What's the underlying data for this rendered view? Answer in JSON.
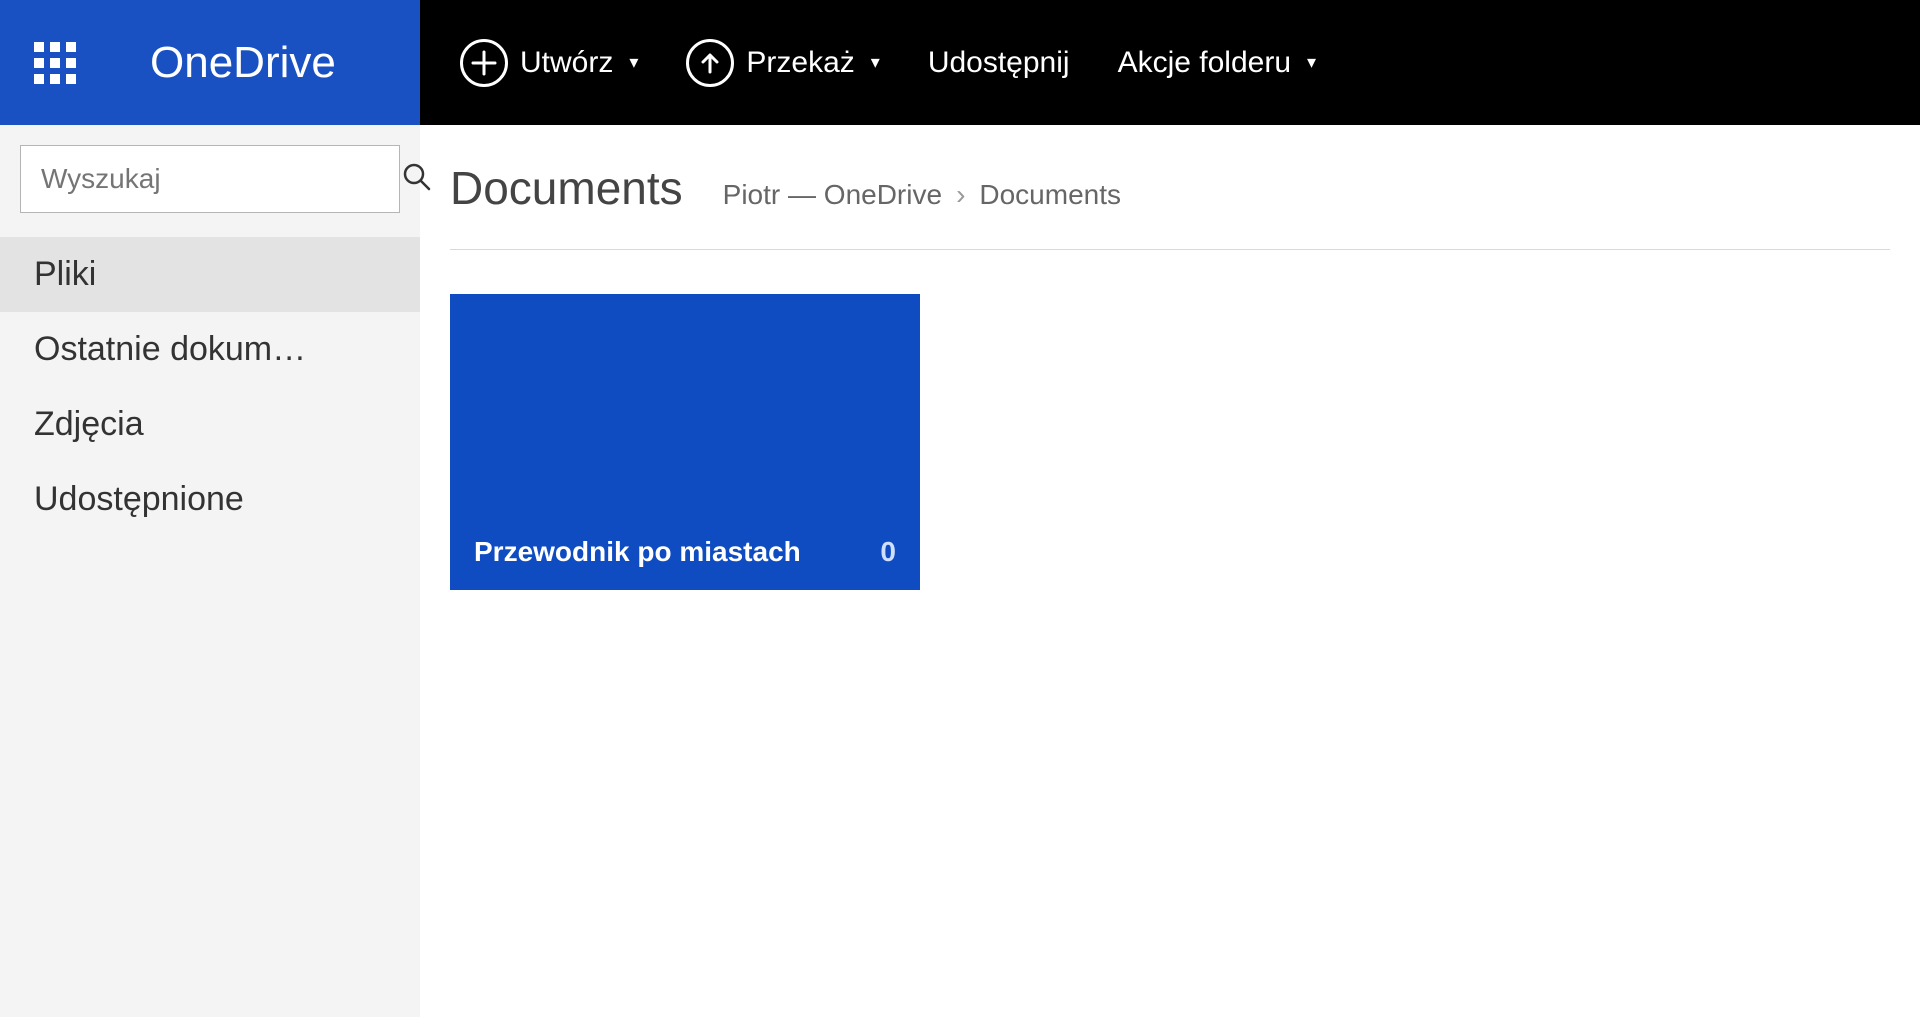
{
  "header": {
    "app_title": "OneDrive",
    "toolbar": {
      "create": "Utwórz",
      "upload": "Przekaż",
      "share": "Udostępnij",
      "folder_actions": "Akcje folderu"
    }
  },
  "sidebar": {
    "search_placeholder": "Wyszukaj",
    "nav": [
      {
        "label": "Pliki",
        "active": true
      },
      {
        "label": "Ostatnie dokum…",
        "active": false
      },
      {
        "label": "Zdjęcia",
        "active": false
      },
      {
        "label": "Udostępnione",
        "active": false
      }
    ]
  },
  "main": {
    "page_title": "Documents",
    "breadcrumb": {
      "root": "Piotr — OneDrive",
      "current": "Documents"
    },
    "tiles": [
      {
        "name": "Przewodnik po miastach",
        "count": "0"
      }
    ]
  },
  "colors": {
    "brand_blue": "#1a51c2",
    "tile_blue": "#0f4cc1",
    "header_black": "#000000"
  }
}
